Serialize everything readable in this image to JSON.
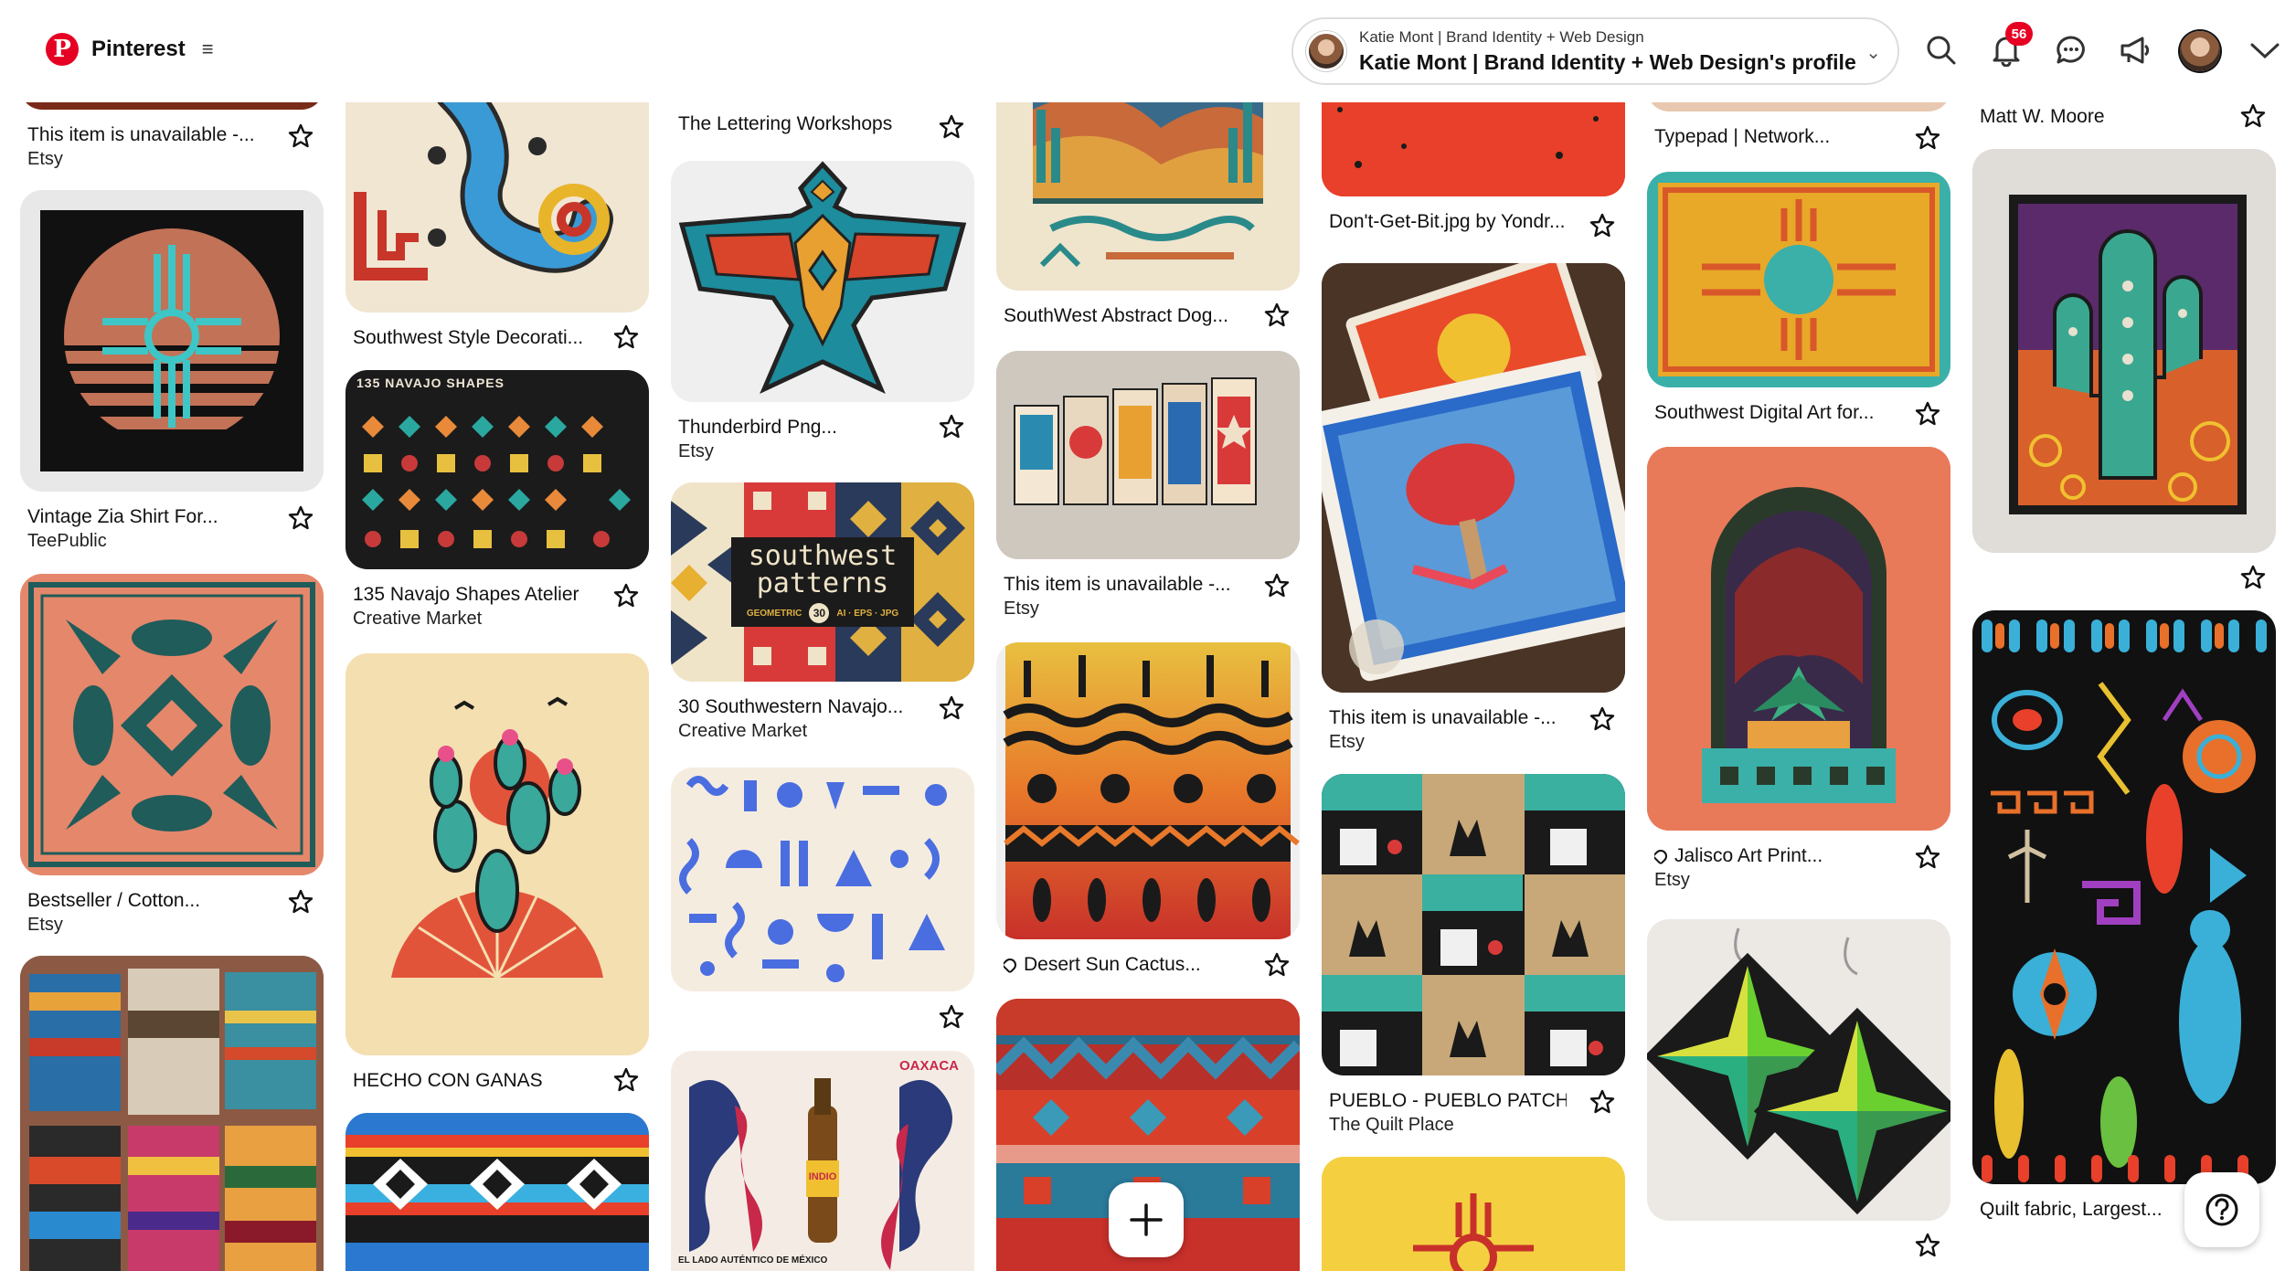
{
  "header": {
    "brand": "Pinterest",
    "profile_sub": "Katie Mont | Brand Identity + Web Design",
    "profile_main": "Katie Mont | Brand Identity + Web Design's profile",
    "notifications_count": "56",
    "icons": [
      "search-icon",
      "bell-icon",
      "messages-icon",
      "megaphone-icon",
      "avatar",
      "chevron-down-icon"
    ]
  },
  "pins": [
    {
      "title": "This item is unavailable -...",
      "source": "Etsy"
    },
    {
      "title": "Vintage Zia Shirt For...",
      "source": "TeePublic"
    },
    {
      "title": "Bestseller / Cotton...",
      "source": "Etsy"
    },
    {
      "title": "Southwest Style Decorati...",
      "source": ""
    },
    {
      "title": "135 Navajo Shapes Atelier",
      "source": "Creative Market"
    },
    {
      "title": "HECHO CON GANAS",
      "source": ""
    },
    {
      "title": "The Lettering Workshops",
      "source": ""
    },
    {
      "title": "Thunderbird Png...",
      "source": "Etsy"
    },
    {
      "title": "30 Southwestern Navajo...",
      "source": "Creative Market"
    },
    {
      "title": "SouthWest Abstract Dog...",
      "source": ""
    },
    {
      "title": "This item is unavailable -...",
      "source": "Etsy"
    },
    {
      "title": "Desert Sun Cactus...",
      "source": ""
    },
    {
      "title": "Don't-Get-Bit.jpg by Yondr...",
      "source": ""
    },
    {
      "title": "This item is unavailable -...",
      "source": "Etsy"
    },
    {
      "title": "PUEBLO - PUEBLO PATCH",
      "source": "The Quilt Place"
    },
    {
      "title": "Typepad | Network...",
      "source": ""
    },
    {
      "title": "Southwest Digital Art for...",
      "source": ""
    },
    {
      "title": "Jalisco Art Print...",
      "source": "Etsy"
    },
    {
      "title": "Matt W. Moore",
      "source": ""
    },
    {
      "title": "Quilt fabric, Largest...",
      "source": ""
    }
  ],
  "image_text": {
    "navajo_shapes": "135 NAVAJO SHAPES",
    "sw_patterns_1": "southwest",
    "sw_patterns_2": "patterns",
    "sw_patterns_3": "GEOMETRIC",
    "sw_patterns_num": "30",
    "sw_patterns_4": "AI · EPS · JPG",
    "beer_label": "INDIO",
    "beer_caption": "EL LADO AUTÉNTICO DE MÉXICO",
    "oaxaca": "OAXACA"
  },
  "colors": {
    "brand": "#e60023"
  }
}
